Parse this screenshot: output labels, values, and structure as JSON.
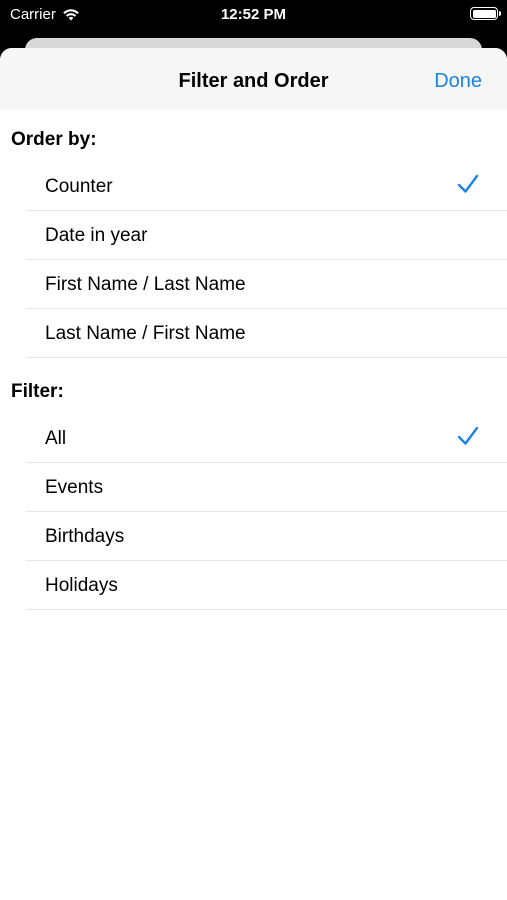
{
  "status_bar": {
    "carrier": "Carrier",
    "time": "12:52 PM",
    "battery_level": 1.0
  },
  "nav": {
    "title": "Filter and Order",
    "done_label": "Done"
  },
  "colors": {
    "accent": "#1a82e2",
    "separator": "#e6e6e6",
    "nav_background": "#f7f7f7"
  },
  "order_section": {
    "header": "Order by:",
    "items": [
      {
        "label": "Counter",
        "selected": true
      },
      {
        "label": "Date in year",
        "selected": false
      },
      {
        "label": "First Name / Last Name",
        "selected": false
      },
      {
        "label": "Last Name / First Name",
        "selected": false
      }
    ]
  },
  "filter_section": {
    "header": "Filter:",
    "items": [
      {
        "label": "All",
        "selected": true
      },
      {
        "label": "Events",
        "selected": false
      },
      {
        "label": "Birthdays",
        "selected": false
      },
      {
        "label": "Holidays",
        "selected": false
      }
    ]
  },
  "icons": {
    "wifi": "wifi-icon",
    "battery": "battery-icon",
    "checkmark": "checkmark-icon"
  }
}
